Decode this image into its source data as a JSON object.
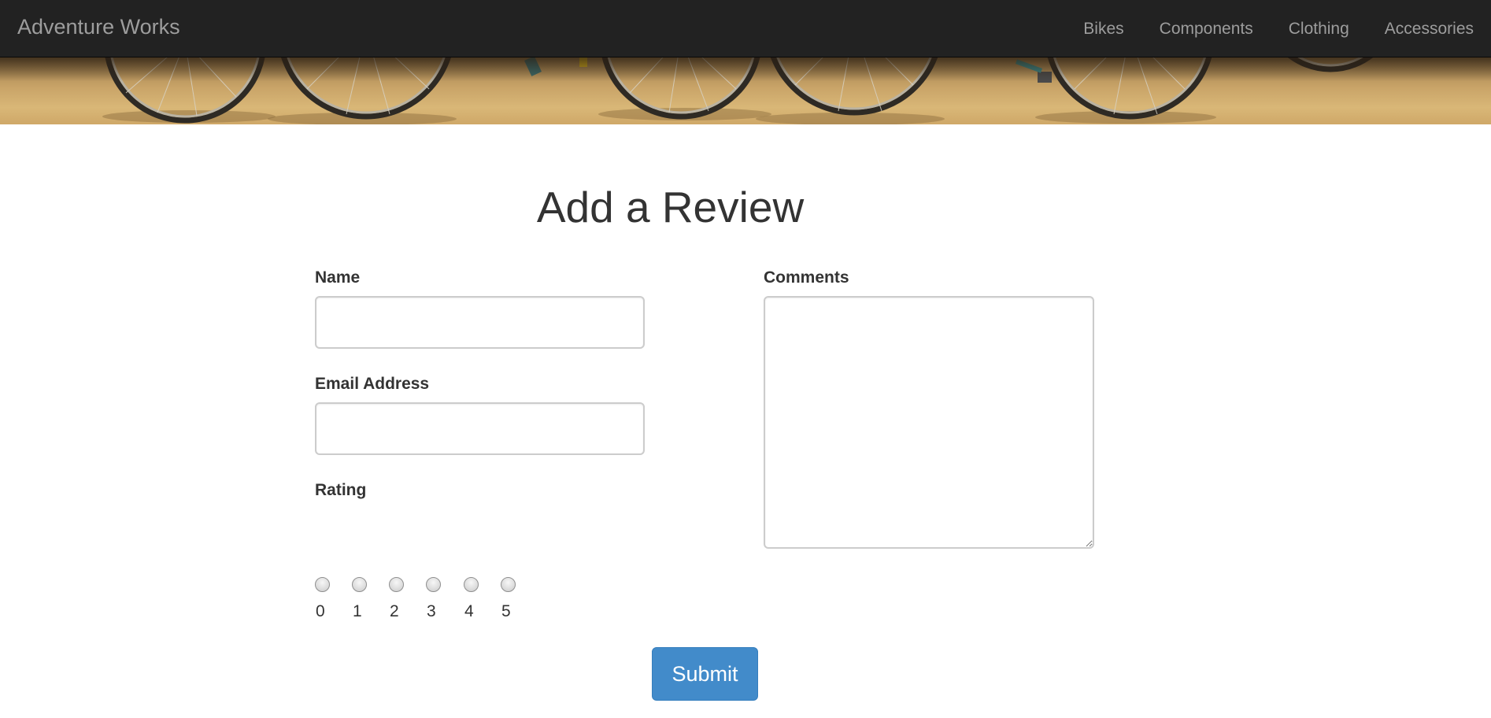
{
  "navbar": {
    "brand": "Adventure Works",
    "items": [
      {
        "label": "Bikes"
      },
      {
        "label": "Components"
      },
      {
        "label": "Clothing"
      },
      {
        "label": "Accessories"
      }
    ]
  },
  "banner": {
    "image": "bicycle-wheels-on-sand"
  },
  "main": {
    "title": "Add a Review",
    "name_label": "Name",
    "name_value": "",
    "email_label": "Email Address",
    "email_value": "",
    "comments_label": "Comments",
    "comments_value": "",
    "rating_label": "Rating",
    "rating_options": [
      "0",
      "1",
      "2",
      "3",
      "4",
      "5"
    ],
    "rating_selected": null,
    "submit_label": "Submit"
  },
  "colors": {
    "navbar_bg": "#222222",
    "navbar_text": "#9d9d9d",
    "primary_button": "#428bca",
    "text": "#333333"
  }
}
